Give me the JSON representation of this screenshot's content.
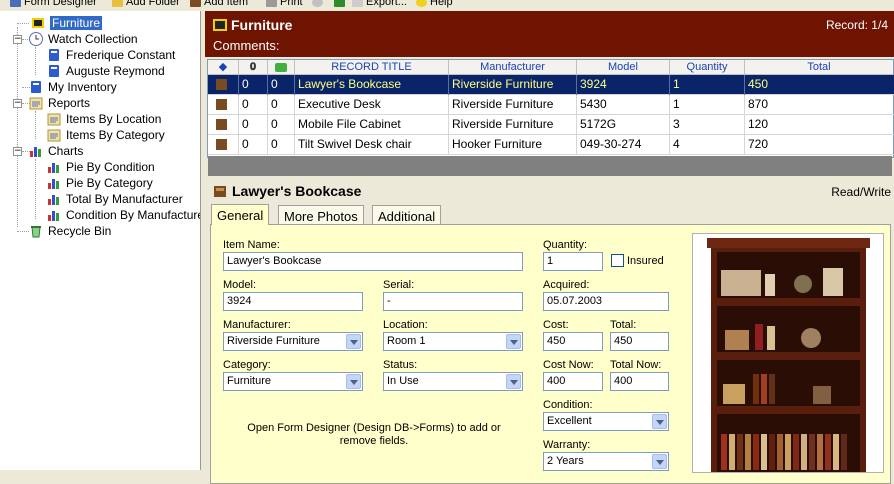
{
  "toolbar": {
    "items": [
      {
        "label": "Form Designer"
      },
      {
        "label": "Add Folder"
      },
      {
        "label": "Add Item"
      },
      {
        "label": "Print"
      },
      {
        "label": "Export..."
      },
      {
        "label": "Help"
      }
    ]
  },
  "tree": {
    "furniture": "Furniture",
    "watch_collection": "Watch Collection",
    "frederique": "Frederique Constant",
    "auguste": "Auguste Reymond",
    "my_inventory": "My Inventory",
    "reports": "Reports",
    "items_by_location": "Items By Location",
    "items_by_category": "Items By Category",
    "charts": "Charts",
    "pie_by_condition": "Pie By Condition",
    "pie_by_category": "Pie By Category",
    "total_by_manufacturer": "Total By Manufacturer",
    "condition_by_manufacturer": "Condition By Manufacturer",
    "recycle_bin": "Recycle Bin"
  },
  "header": {
    "title": "Furniture",
    "record": "Record: 1/4",
    "comments": "Comments:"
  },
  "grid": {
    "columns": [
      "0",
      "0",
      "RECORD TITLE",
      "Manufacturer",
      "Model",
      "Quantity",
      "Total"
    ],
    "rows": [
      {
        "att": "0",
        "chk": "0",
        "title": "Lawyer's Bookcase",
        "manufacturer": "Riverside Furniture",
        "model": "3924",
        "quantity": "1",
        "total": "450"
      },
      {
        "att": "0",
        "chk": "0",
        "title": "Executive Desk",
        "manufacturer": "Riverside Furniture",
        "model": "5430",
        "quantity": "1",
        "total": "870"
      },
      {
        "att": "0",
        "chk": "0",
        "title": "Mobile File Cabinet",
        "manufacturer": "Riverside Furniture",
        "model": "5172G",
        "quantity": "3",
        "total": "120"
      },
      {
        "att": "0",
        "chk": "0",
        "title": "Tilt Swivel Desk chair",
        "manufacturer": "Hooker Furniture",
        "model": "049-30-274",
        "quantity": "4",
        "total": "720"
      }
    ]
  },
  "detail": {
    "title": "Lawyer's Bookcase",
    "mode": "Read/Write",
    "tabs": [
      "General",
      "More Photos",
      "Additional"
    ],
    "fields": {
      "item_name_label": "Item Name:",
      "item_name": "Lawyer's Bookcase",
      "model_label": "Model:",
      "model": "3924",
      "serial_label": "Serial:",
      "serial": "-",
      "manufacturer_label": "Manufacturer:",
      "manufacturer": "Riverside Furniture",
      "location_label": "Location:",
      "location": "Room 1",
      "category_label": "Category:",
      "category": "Furniture",
      "status_label": "Status:",
      "status": "In Use",
      "quantity_label": "Quantity:",
      "quantity": "1",
      "insured_label": "Insured",
      "acquired_label": "Acquired:",
      "acquired": "05.07.2003",
      "cost_label": "Cost:",
      "cost": "450",
      "total_label": "Total:",
      "total": "450",
      "cost_now_label": "Cost Now:",
      "cost_now": "400",
      "total_now_label": "Total Now:",
      "total_now": "400",
      "condition_label": "Condition:",
      "condition": "Excellent",
      "warranty_label": "Warranty:",
      "warranty": "2 Years"
    },
    "hint": "Open Form Designer (Design DB->Forms) to add or remove fields."
  }
}
